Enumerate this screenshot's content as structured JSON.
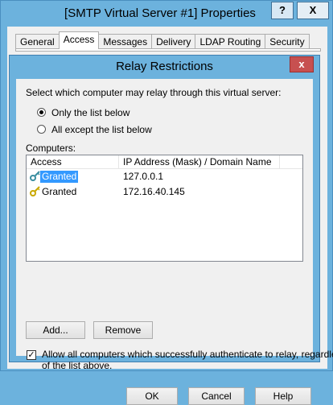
{
  "outer_window": {
    "title": "[SMTP Virtual Server #1] Properties",
    "help_button": "?",
    "close_button": "X",
    "tabs": [
      "General",
      "Access",
      "Messages",
      "Delivery",
      "LDAP Routing",
      "Security"
    ],
    "active_tab": "Access"
  },
  "dialog": {
    "title": "Relay Restrictions",
    "close_button": "x",
    "instruction": "Select which computer may relay through this virtual server:",
    "radio_options": [
      {
        "label": "Only the list below",
        "selected": true
      },
      {
        "label": "All except the list below",
        "selected": false
      }
    ],
    "computers_label": "Computers:",
    "list": {
      "columns": [
        "Access",
        "IP Address (Mask) / Domain Name"
      ],
      "rows": [
        {
          "access": "Granted",
          "address": "127.0.0.1",
          "selected": true
        },
        {
          "access": "Granted",
          "address": "172.16.40.145",
          "selected": false
        }
      ]
    },
    "add_button": "Add...",
    "remove_button": "Remove",
    "checkbox": {
      "checked": true,
      "label_line1": "Allow all computers which successfully authenticate to relay, regardless",
      "label_line2": "of the list above."
    },
    "ok_button": "OK",
    "cancel_button": "Cancel",
    "help_button": "Help"
  },
  "colors": {
    "title_bar": "#6cb2dd",
    "close_red": "#c75050",
    "selection": "#3399ff"
  }
}
